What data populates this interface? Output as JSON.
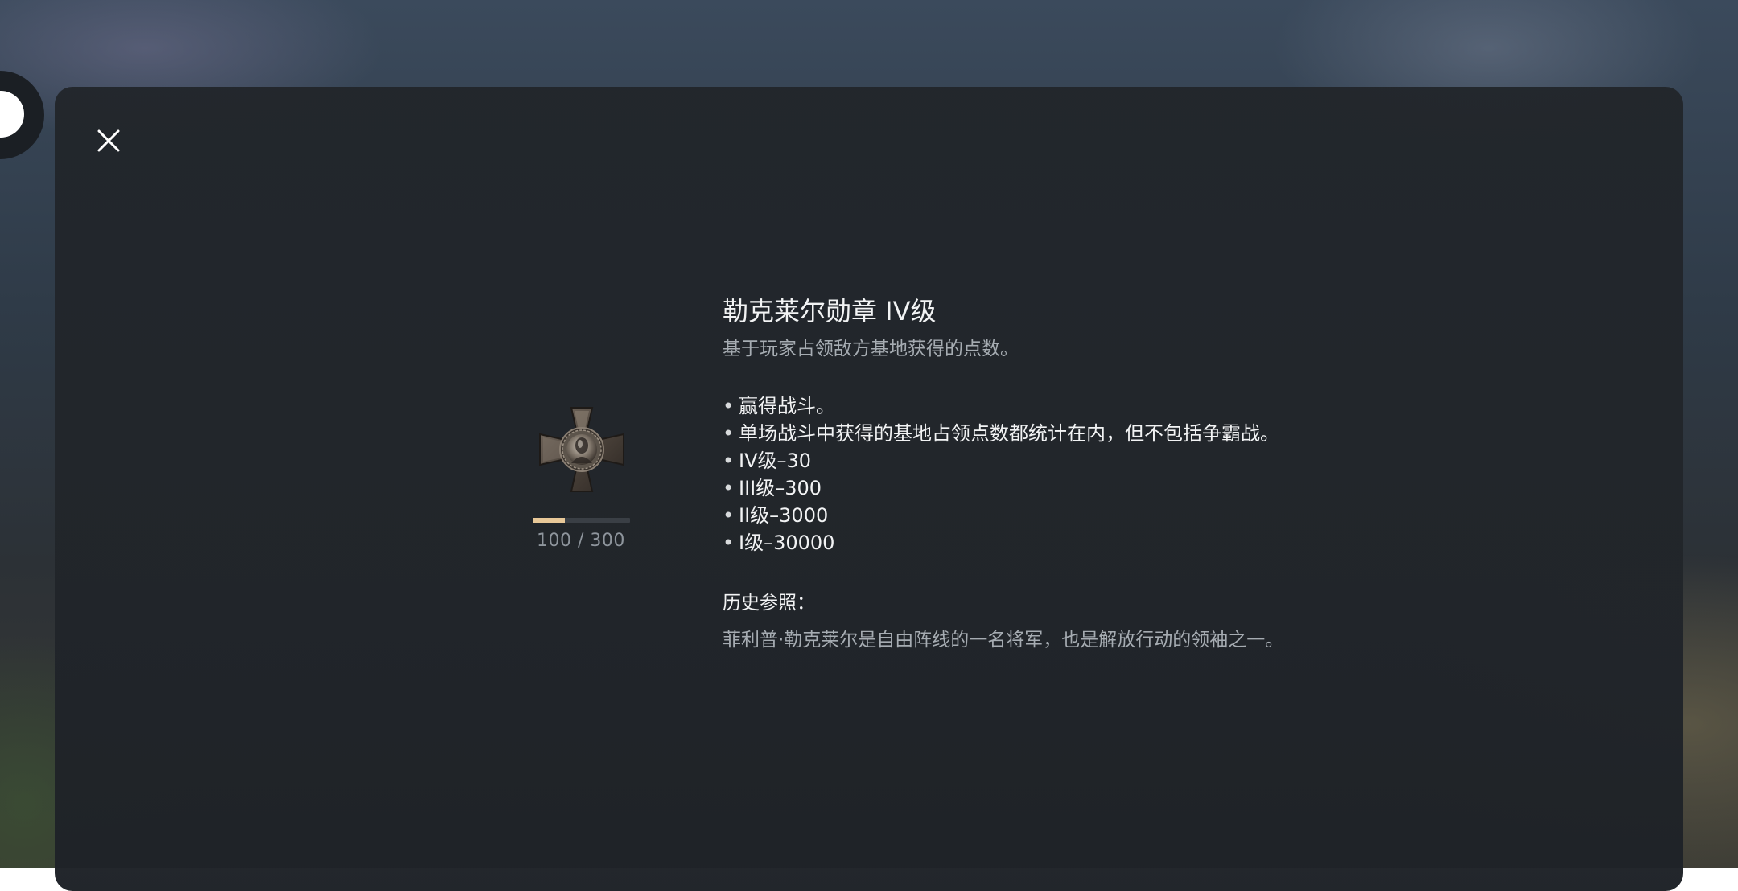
{
  "dialog": {
    "close_icon": "close-icon",
    "medal": {
      "icon": "iron-cross-medal-icon",
      "progress": {
        "current": 100,
        "max": 300,
        "text": "100 / 300",
        "fill_color": "#e8c898"
      }
    },
    "title": "勒克莱尔勋章 IV级",
    "subtitle": "基于玩家占领敌方基地获得的点数。",
    "rules": [
      "赢得战斗。",
      "单场战斗中获得的基地占领点数都统计在内，但不包括争霸战。",
      "IV级–30",
      "III级–300",
      "II级–3000",
      "I级–30000"
    ],
    "history_title": "历史参照：",
    "history_text": "菲利普·勒克莱尔是自由阵线的一名将军，也是解放行动的领袖之一。"
  }
}
